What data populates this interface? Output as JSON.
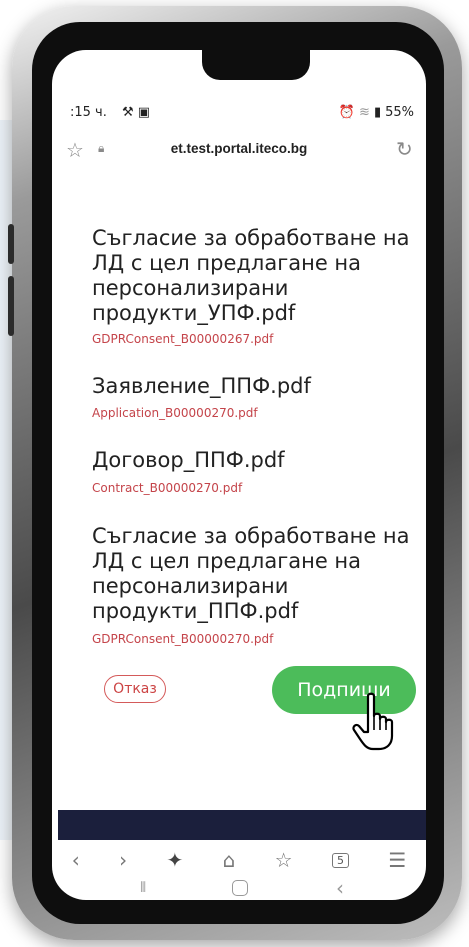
{
  "status": {
    "time": ":15 ч.",
    "battery": "55%"
  },
  "browser": {
    "url": "et.test.portal.iteco.bg"
  },
  "documents": [
    {
      "title": "Съгласие за обработване на ЛД с цел предлагане на персонализирани продукти_УПФ.pdf",
      "file": "GDPRConsent_B00000267.pdf"
    },
    {
      "title": "Заявление_ППФ.pdf",
      "file": "Application_B00000270.pdf"
    },
    {
      "title": "Договор_ППФ.pdf",
      "file": "Contract_B00000270.pdf"
    },
    {
      "title": "Съгласие за обработване на ЛД с цел предлагане на персонализирани продукти_ППФ.pdf",
      "file": "GDPRConsent_B00000270.pdf"
    }
  ],
  "actions": {
    "cancel_label": "Отказ",
    "sign_label": "Подпиши"
  },
  "toolbar": {
    "tab_count": "5"
  },
  "colors": {
    "sign_button": "#4cbc5a",
    "cancel_border": "#d45a5a",
    "file_link": "#c4444a",
    "footer_band": "#1b1f3c"
  }
}
